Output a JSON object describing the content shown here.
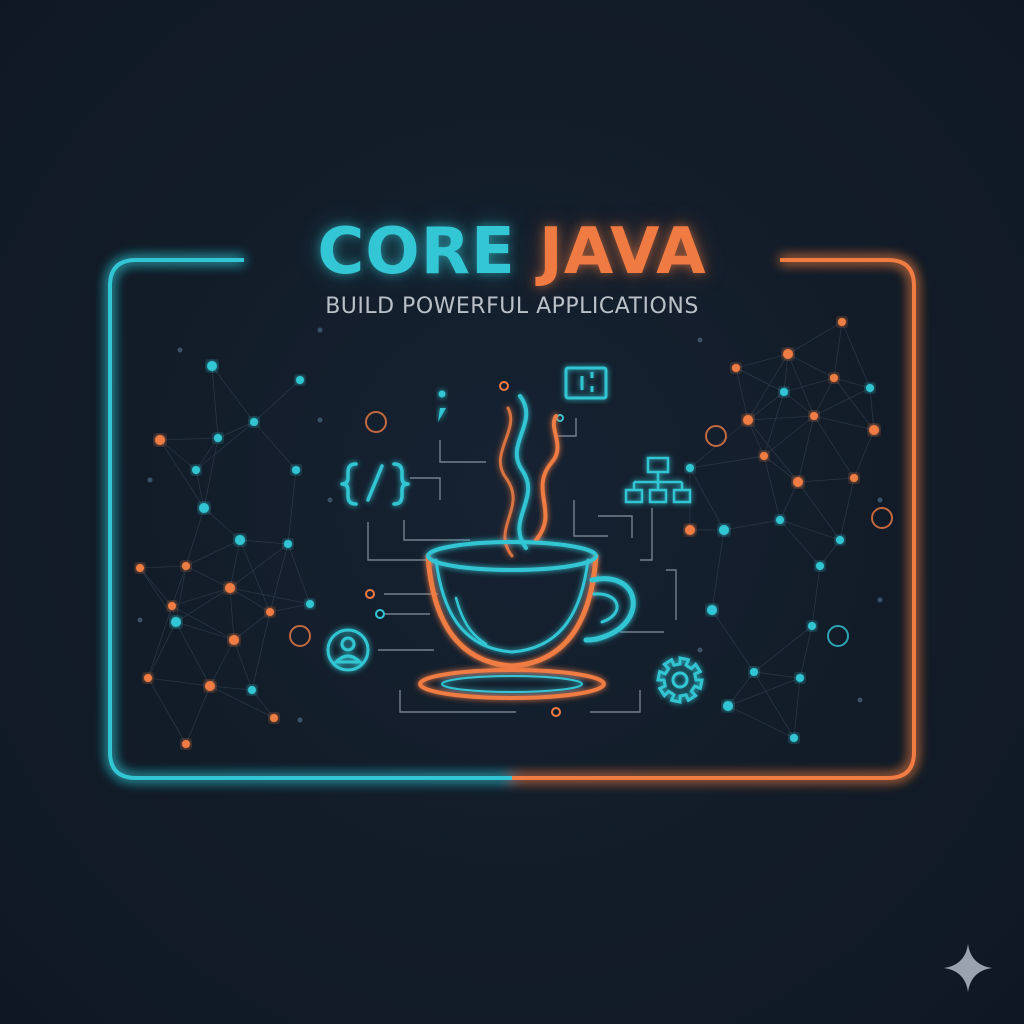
{
  "banner": {
    "title_part1": "CORE",
    "title_part2": "JAVA",
    "subtitle": "BUILD POWERFUL APPLICATIONS"
  },
  "colors": {
    "background": "#121c28",
    "cyan": "#33c6d4",
    "orange": "#ef7b43",
    "subtitle_gray": "#b9c0c8"
  },
  "icons": [
    "coffee-cup-icon",
    "code-brackets-icon",
    "user-profile-icon",
    "hierarchy-icon",
    "gear-icon",
    "window-icon",
    "semicolon-icon",
    "sparkle-icon"
  ]
}
